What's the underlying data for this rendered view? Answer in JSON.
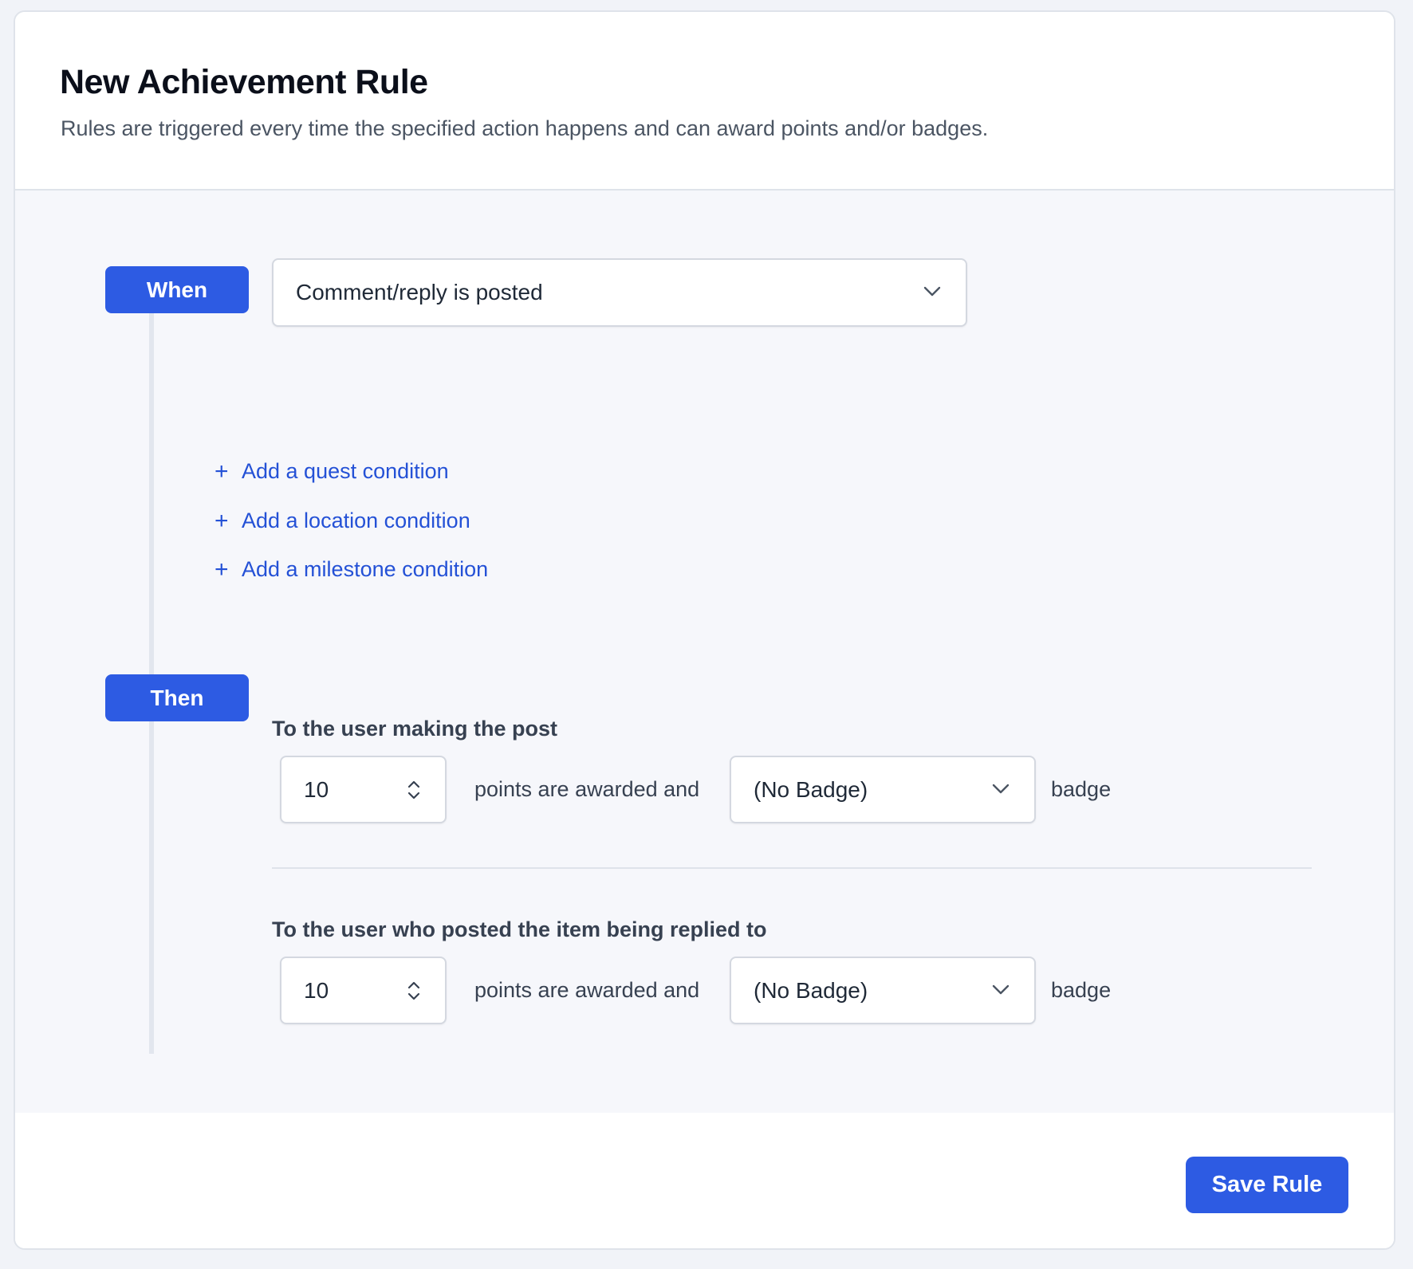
{
  "header": {
    "title": "New Achievement Rule",
    "subtitle": "Rules are triggered every time the specified action happens and can award points and/or badges."
  },
  "when": {
    "label": "When",
    "trigger_value": "Comment/reply is posted"
  },
  "conditions": [
    {
      "label": "Add a quest condition"
    },
    {
      "label": "Add a location condition"
    },
    {
      "label": "Add a milestone condition"
    }
  ],
  "then": {
    "label": "Then",
    "awards": [
      {
        "heading": "To the user making the post",
        "points": "10",
        "points_text": "points are awarded and",
        "badge_value": "(No Badge)",
        "badge_text": "badge"
      },
      {
        "heading": "To the user who posted the item being replied to",
        "points": "10",
        "points_text": "points are awarded and",
        "badge_value": "(No Badge)",
        "badge_text": "badge"
      }
    ]
  },
  "footer": {
    "save_label": "Save Rule"
  },
  "icons": {
    "plus": "plus-icon",
    "dropdown": "chevron-down-icon",
    "stepper": "stepper-icon"
  },
  "colors": {
    "accent": "#2d5be3",
    "link": "#2451d6",
    "body_bg": "#f6f7fb"
  }
}
